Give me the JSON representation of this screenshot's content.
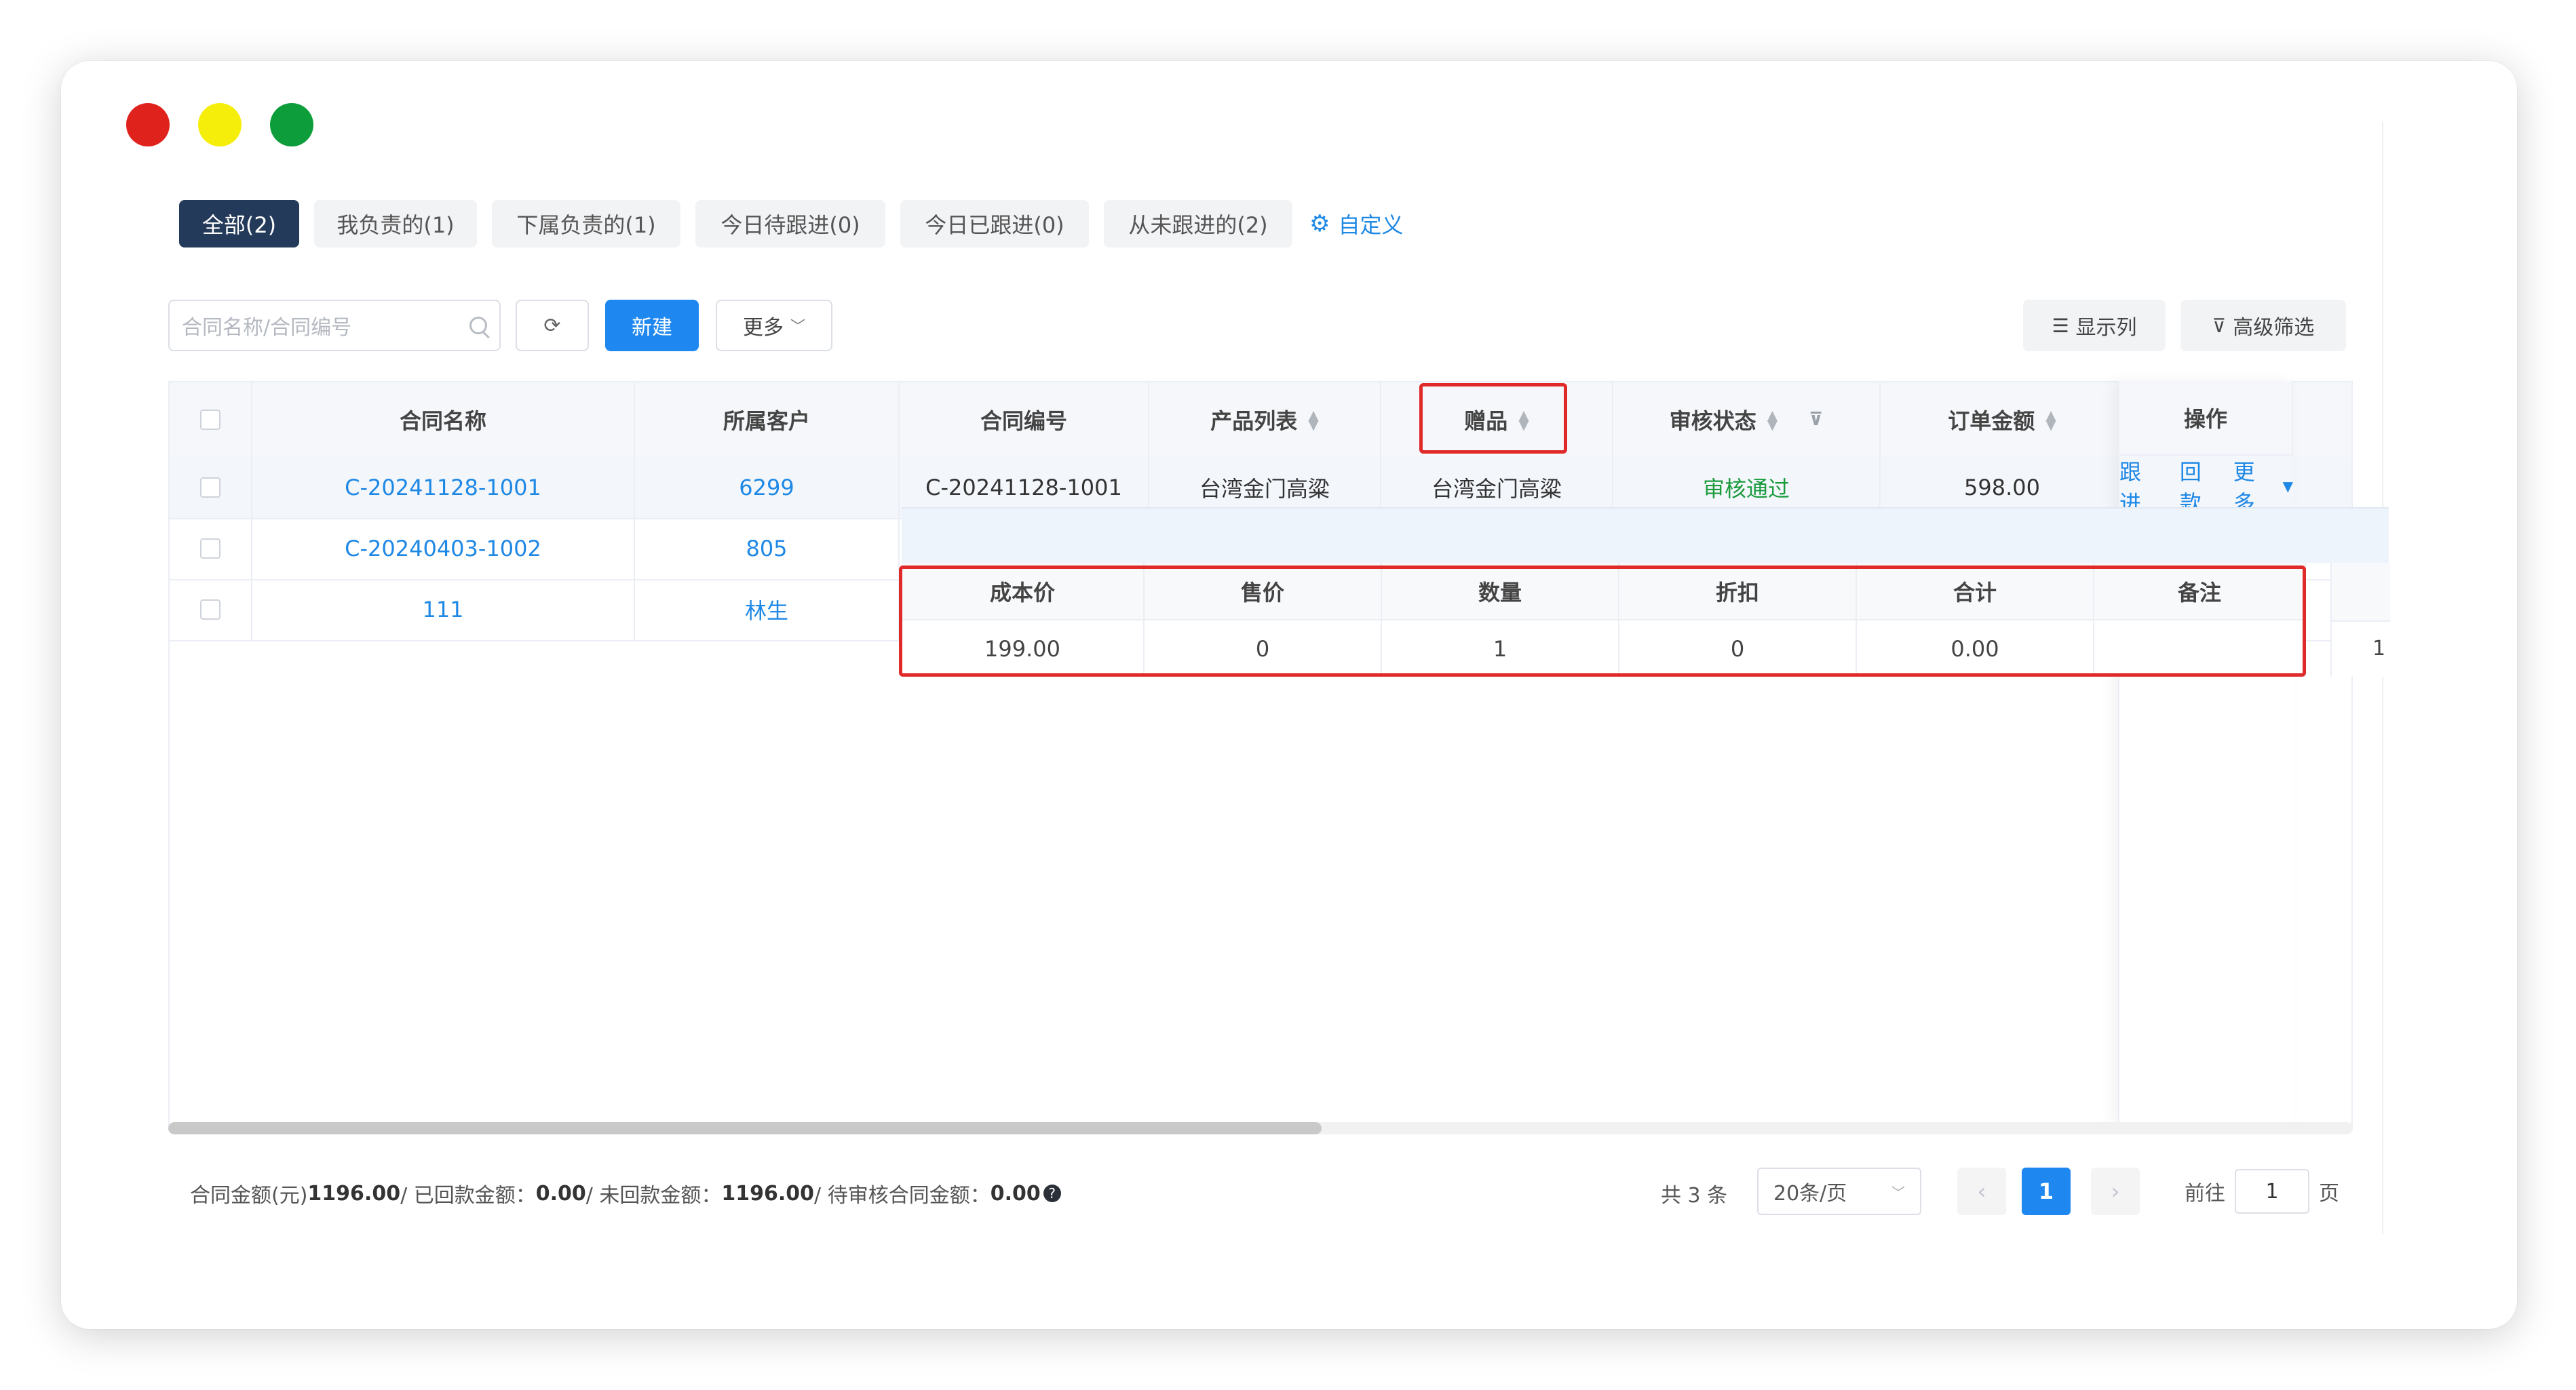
{
  "tabs": [
    {
      "label": "全部(2)",
      "active": true
    },
    {
      "label": "我负责的(1)"
    },
    {
      "label": "下属负责的(1)"
    },
    {
      "label": "今日待跟进(0)"
    },
    {
      "label": "今日已跟进(0)"
    },
    {
      "label": "从未跟进的(2)"
    }
  ],
  "custom_link": "自定义",
  "toolbar": {
    "search_placeholder": "合同名称/合同编号",
    "new_label": "新建",
    "more_label": "更多",
    "show_columns": "显示列",
    "advanced_filter": "高级筛选"
  },
  "columns": [
    "合同名称",
    "所属客户",
    "合同编号",
    "产品列表",
    "赠品",
    "审核状态",
    "订单金额",
    "操作"
  ],
  "rows": [
    {
      "name": "C-20241128-1001",
      "customer": "6299",
      "number": "C-20241128-1001",
      "products": "台湾金门高粱",
      "gift": "台湾金门高粱",
      "status": "审核通过",
      "amount": "598.00"
    },
    {
      "name": "C-20240403-1002",
      "customer": "805"
    },
    {
      "name": "111",
      "customer": "林生"
    }
  ],
  "ops": {
    "follow": "跟进",
    "payment": "回款",
    "more": "更多"
  },
  "gift_sub": {
    "headers": [
      "成本价",
      "售价",
      "数量",
      "折扣",
      "合计",
      "备注"
    ],
    "values": [
      "199.00",
      "0",
      "1",
      "0",
      "0.00",
      ""
    ],
    "extra_cell": "1"
  },
  "summary": {
    "l1": "合同金额(元)",
    "v1": "1196.00",
    "l2": "/ 已回款金额：",
    "v2": "0.00",
    "l3": "/ 未回款金额：",
    "v3": "1196.00",
    "l4": "/ 待审核合同金额：",
    "v4": "0.00"
  },
  "pager": {
    "total": "共 3 条",
    "page_size": "20条/页",
    "current": "1",
    "goto_prefix": "前往",
    "goto_value": "1",
    "goto_suffix": "页"
  }
}
